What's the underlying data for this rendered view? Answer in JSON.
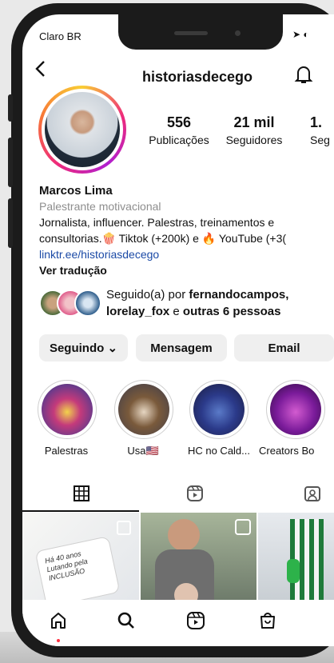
{
  "status": {
    "carrier": "Claro BR",
    "icons": "➤ ◐"
  },
  "header": {
    "username": "historiasdecego",
    "back_icon": "back-arrow-icon",
    "bell_icon": "bell-icon"
  },
  "profile": {
    "stats": [
      {
        "value": "556",
        "label": "Publicações"
      },
      {
        "value": "21 mil",
        "label": "Seguidores"
      },
      {
        "value": "1.",
        "label": "Seg"
      }
    ],
    "name": "Marcos Lima",
    "category": "Palestrante motivacional",
    "bio_line1": "Jornalista, influencer. Palestras, treinamentos e",
    "bio_line2": "consultorias.🍿 Tiktok (+200k) e 🔥 YouTube (+3(",
    "link": "linktr.ee/historiasdecego",
    "translate": "Ver tradução",
    "followed_prefix": "Seguido(a) por ",
    "followed_user1": "fernandocampos,",
    "followed_user2": "lorelay_fox",
    "followed_mid": " e ",
    "followed_rest": "outras 6 pessoas"
  },
  "actions": {
    "following": "Seguindo ⌄",
    "message": "Mensagem",
    "email": "Email"
  },
  "highlights": [
    "Palestras",
    "Usa🇺🇸",
    "HC no Cald...",
    "Creators Bo"
  ],
  "post_text": "Há 40 anos Lutando pela INCLUSÃO",
  "colors": {
    "accent": "#ee2a7b",
    "link": "#1b4aa6",
    "notification_dot": "#ff3040"
  }
}
